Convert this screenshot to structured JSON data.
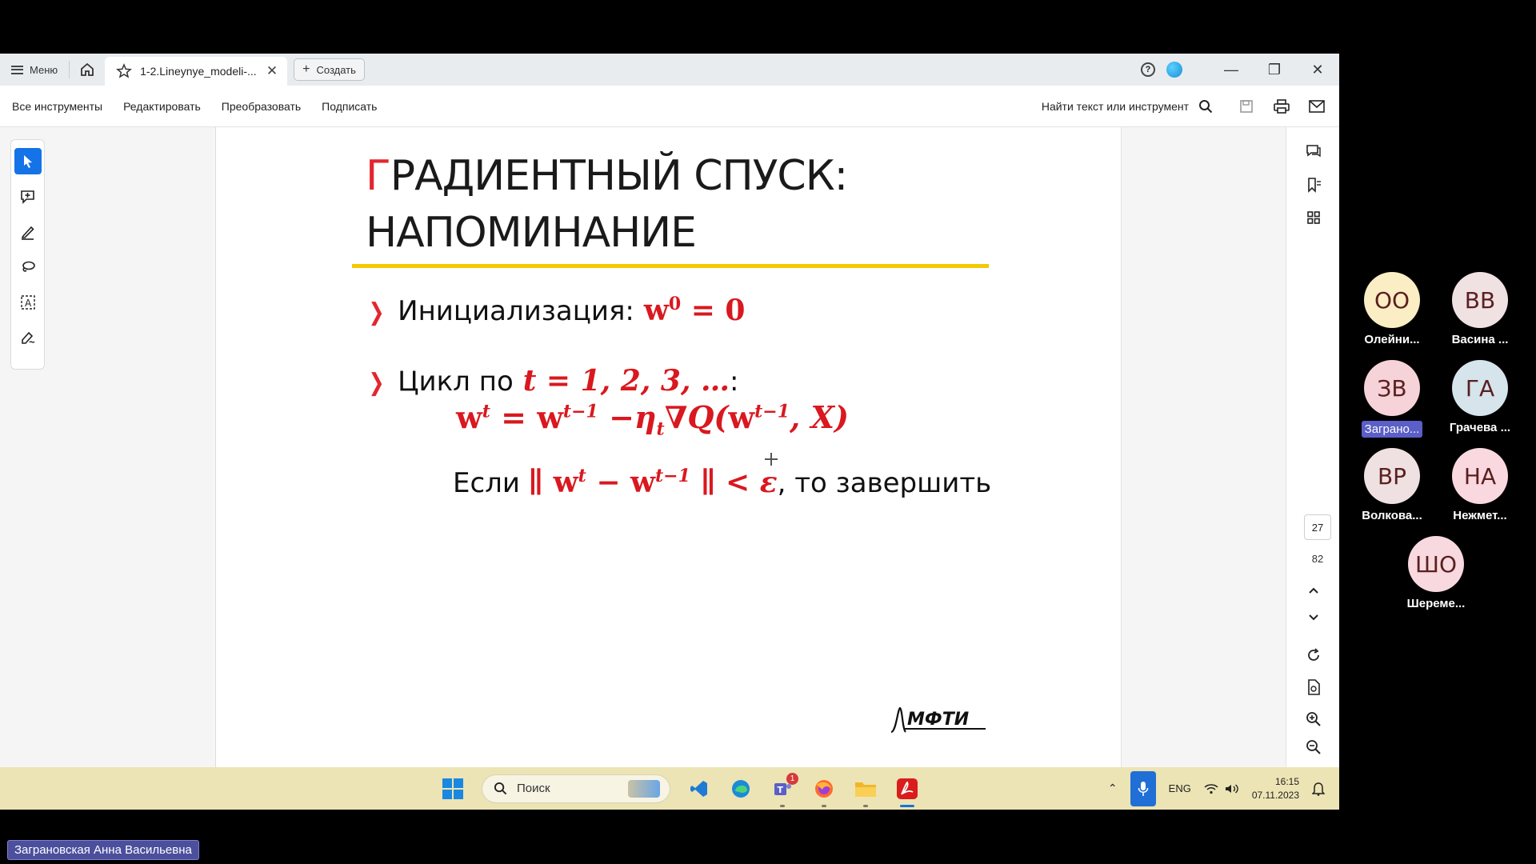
{
  "tabbar": {
    "menu_label": "Меню",
    "doc_tab_title": "1-2.Lineynye_modeli-...",
    "create_label": "Создать"
  },
  "toolbar": {
    "items": [
      "Все инструменты",
      "Редактировать",
      "Преобразовать",
      "Подписать"
    ],
    "find_label": "Найти текст или инструмент"
  },
  "slide": {
    "title_first_letter": "Г",
    "title_line1_rest": "РАДИЕНТНЫЙ СПУСК:",
    "title_line2": "НАПОМИНАНИЕ",
    "bullet1_text": "Инициализация:",
    "bullet1_math_base": "w",
    "bullet1_math_sup": "0",
    "bullet1_math_rest": "= 0",
    "bullet2_text": "Цикл по",
    "bullet2_math": "t = 1, 2, 3, …",
    "bullet2_colon": ":",
    "formula_lhs_base": "w",
    "formula_lhs_sup": "t",
    "formula_eq": "=",
    "formula_w2": "w",
    "formula_w2_sup": "t−1",
    "formula_minus_eta": "−η",
    "formula_eta_sub": "t",
    "formula_grad": "∇Q(",
    "formula_w3": "w",
    "formula_w3_sup": "t−1",
    "formula_tail": ", X)",
    "stop_prefix": "Если",
    "stop_norm_open": "∥ w",
    "stop_sup_t": "t",
    "stop_minus": "− w",
    "stop_sup_t1": "t−1",
    "stop_norm_close": "∥ < ε",
    "stop_suffix": ", то завершить",
    "logo_text": "МФТИ"
  },
  "pages": {
    "current": "27",
    "total": "82"
  },
  "taskbar": {
    "search_placeholder": "Поиск",
    "teams_badge": "1",
    "lang": "ENG",
    "time": "16:15",
    "date": "07.11.2023"
  },
  "participants": [
    {
      "initials": "ОО",
      "name": "Олейни...",
      "color": "#fbedc4"
    },
    {
      "initials": "ВВ",
      "name": "Васина ...",
      "color": "#f0e1e3"
    },
    {
      "initials": "ЗВ",
      "name": "Заграно...",
      "color": "#f6d2d9"
    },
    {
      "initials": "ГА",
      "name": "Грачева ...",
      "color": "#d6e4ec"
    },
    {
      "initials": "ВР",
      "name": "Волкова...",
      "color": "#efe0e1"
    },
    {
      "initials": "НА",
      "name": "Нежмет...",
      "color": "#f9d9df"
    },
    {
      "initials": "ШО",
      "name": "Шереме...",
      "color": "#f7d9df"
    }
  ],
  "speaker_label": "Заграновская Анна Васильевна"
}
